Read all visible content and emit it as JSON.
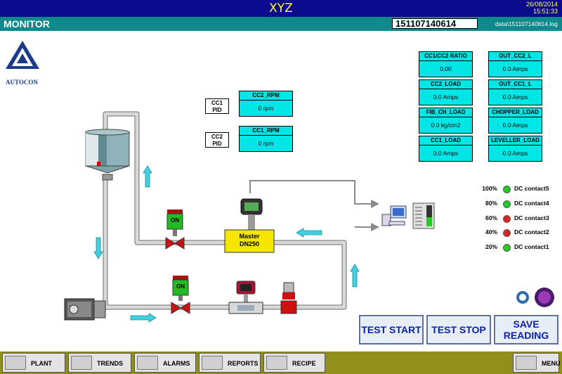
{
  "header": {
    "title": "XYZ",
    "date": "26/08/2014",
    "time": "15:51:33"
  },
  "subheader": {
    "section": "MONITOR",
    "batch_code": "151107140614",
    "log_file": "data\\151107140614.log"
  },
  "logo": {
    "name": "AUTOCON"
  },
  "pid_labels": [
    {
      "line1": "CC1",
      "line2": "PID"
    },
    {
      "line1": "CC2",
      "line2": "PID"
    }
  ],
  "rpm_gauges": [
    {
      "label": "CC2_RPM",
      "value": "0 rpm"
    },
    {
      "label": "CC1_RPM",
      "value": "0 rpm"
    }
  ],
  "readings": [
    {
      "label": "CC1/CC2 RATIO",
      "value": "0.00"
    },
    {
      "label": "OUT_CC2_L",
      "value": "0.0 Amps"
    },
    {
      "label": "CC2_LOAD",
      "value": "0.0 Amps"
    },
    {
      "label": "OUT_CC1_L",
      "value": "0.0 Amps"
    },
    {
      "label": "FIB_CH_LOAD",
      "value": "0.0 kg/cm2"
    },
    {
      "label": "CHOPPER_LOAD",
      "value": "0.0 Amps"
    },
    {
      "label": "CC1_LOAD",
      "value": "0.0 Amps"
    },
    {
      "label": "LEVELLER_LOAD",
      "value": "0.0 Amps"
    }
  ],
  "dc_contacts": [
    {
      "percent": "100%",
      "name": "DC contact5",
      "status_color": "#22cc22"
    },
    {
      "percent": "80%",
      "name": "DC contact4",
      "status_color": "#22cc22"
    },
    {
      "percent": "60%",
      "name": "DC contact3",
      "status_color": "#dd2222"
    },
    {
      "percent": "40%",
      "name": "DC contact2",
      "status_color": "#dd2222"
    },
    {
      "percent": "20%",
      "name": "DC contact1",
      "status_color": "#22cc22"
    }
  ],
  "valves": {
    "valve1_state": "ON",
    "valve2_state": "ON"
  },
  "flowmeter": {
    "line1": "Master",
    "line2": "DN250"
  },
  "actions": {
    "test_start": "TEST START",
    "test_stop": "TEST STOP",
    "save_reading": "SAVE READING"
  },
  "nav": {
    "plant": "PLANT",
    "trends": "TRENDS",
    "alarms": "ALARMS",
    "reports": "REPORTS",
    "recipe": "RECIPE",
    "menu": "MENU"
  },
  "colors": {
    "title_bar": "#0a0a8a",
    "sub_bar": "#0f8a8a",
    "gauge_bg": "#00e5e5",
    "nav_bar": "#8f8f1a",
    "pipe": "#c0c0c0",
    "flow_arrow": "#40d0e0"
  }
}
